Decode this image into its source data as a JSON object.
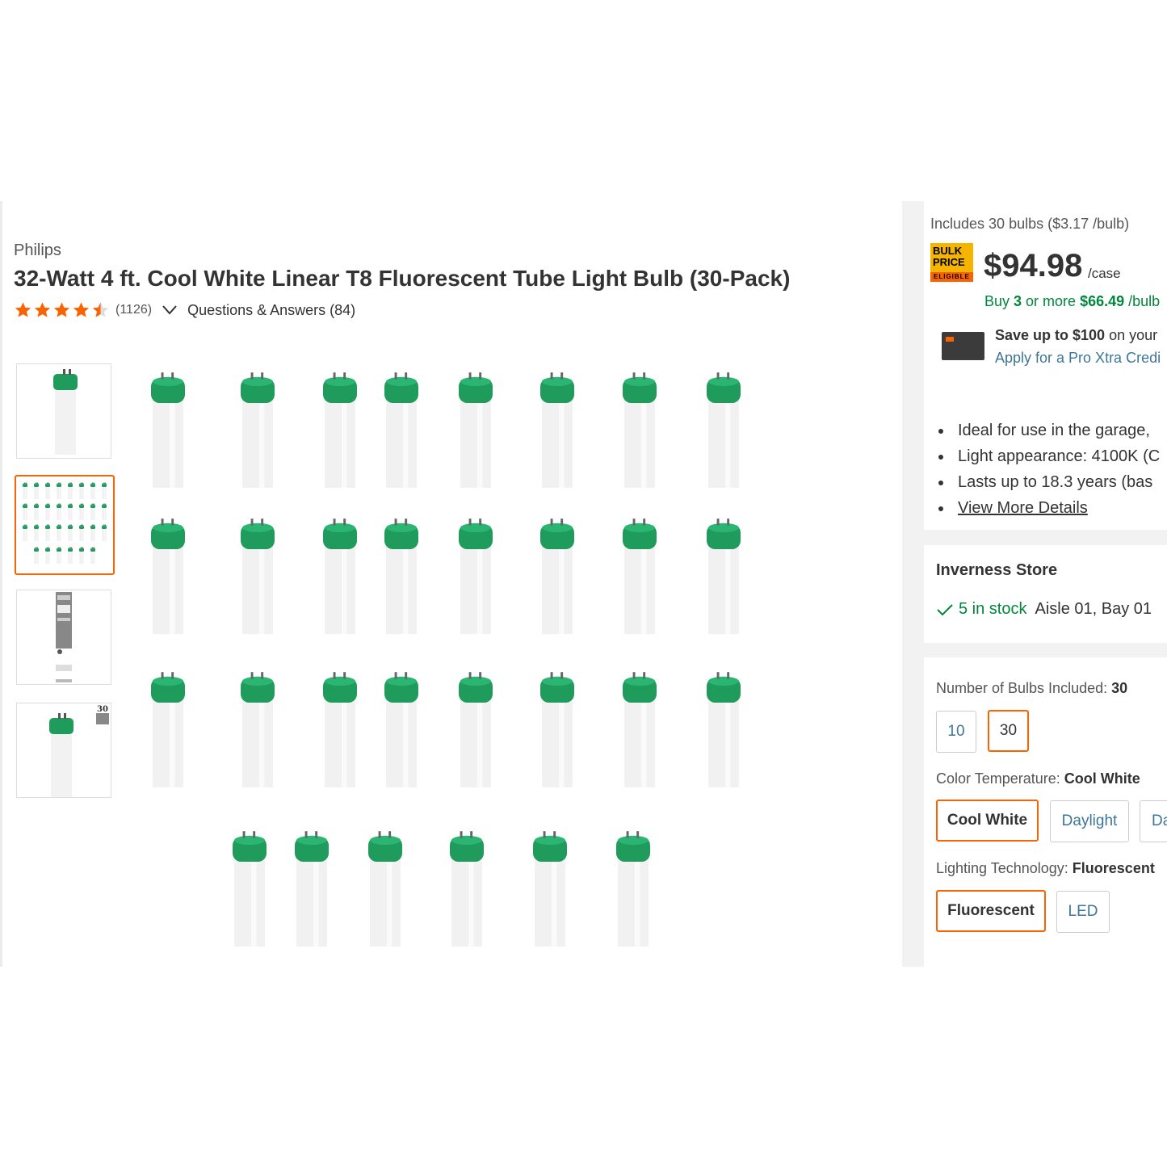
{
  "product": {
    "brand": "Philips",
    "title": "32-Watt 4 ft. Cool White Linear T8 Fluorescent Tube Light Bulb (30-Pack)",
    "rating": 4.5,
    "review_count": "(1126)",
    "qa_link": "Questions & Answers (84)"
  },
  "gallery": {
    "thumbnails": [
      {
        "name": "single-bulb"
      },
      {
        "name": "30-bulb-grid",
        "selected": true
      },
      {
        "name": "package-label"
      },
      {
        "name": "bulb-with-30-pack-badge",
        "badge_text": "30"
      }
    ],
    "tube_count": 30
  },
  "pricing": {
    "includes": "Includes 30 bulbs ($3.17 /bulb)",
    "badge_line1": "BULK",
    "badge_line2": "PRICE",
    "badge_line3": "ELIGIBLE",
    "price": "$94.98",
    "unit": "/case",
    "bulk_prefix": "Buy ",
    "bulk_qty": "3",
    "bulk_middle": " or more ",
    "bulk_price": "$66.49",
    "bulk_suffix": " /bulb",
    "save_bold": "Save up to $100",
    "save_rest": " on your",
    "apply_link": "Apply for a Pro Xtra Credi"
  },
  "highlights": {
    "items": [
      "Ideal for use in the garage,",
      "Light appearance: 4100K (C",
      "Lasts up to 18.3 years (bas"
    ],
    "view_more": "View More Details"
  },
  "store": {
    "name": "Inverness Store",
    "stock": "5 in stock",
    "aisle": "Aisle 01, Bay 01"
  },
  "options": {
    "bulbs": {
      "label": "Number of Bulbs Included: ",
      "value": "30",
      "choices": [
        "10",
        "30"
      ]
    },
    "color": {
      "label": "Color Temperature: ",
      "value": "Cool White",
      "choices": [
        "Cool White",
        "Daylight",
        "Da"
      ]
    },
    "tech": {
      "label": "Lighting Technology: ",
      "value": "Fluorescent",
      "choices": [
        "Fluorescent",
        "LED"
      ]
    }
  },
  "colors": {
    "accent": "#f96302",
    "green": "#00873c",
    "link": "#3e7697",
    "star": "#f96302",
    "tube_cap": "#1f9b5c"
  }
}
